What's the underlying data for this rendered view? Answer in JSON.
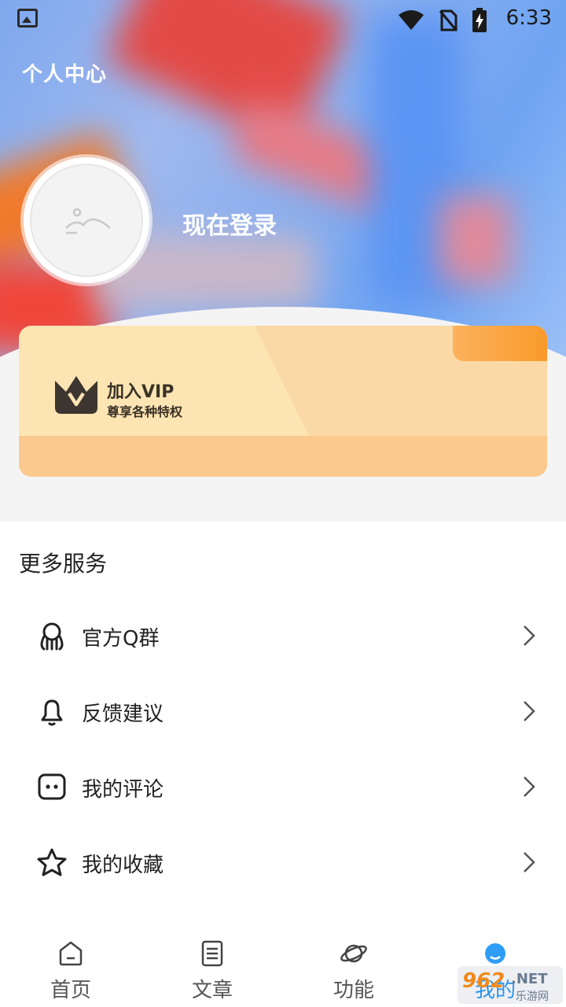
{
  "status_bar": {
    "time": "6:33"
  },
  "header": {
    "title": "个人中心"
  },
  "profile": {
    "login_label": "现在登录"
  },
  "vip_card": {
    "title": "加入VIP",
    "subtitle": "尊享各种特权"
  },
  "services": {
    "title": "更多服务",
    "items": [
      {
        "label": "官方Q群",
        "icon": "qq-group-icon"
      },
      {
        "label": "反馈建议",
        "icon": "bell-icon"
      },
      {
        "label": "我的评论",
        "icon": "comment-icon"
      },
      {
        "label": "我的收藏",
        "icon": "star-icon"
      }
    ]
  },
  "tabbar": {
    "tabs": [
      {
        "label": "首页",
        "icon": "home-icon"
      },
      {
        "label": "文章",
        "icon": "document-icon"
      },
      {
        "label": "功能",
        "icon": "planet-icon"
      },
      {
        "label": "我的",
        "icon": "profile-icon",
        "active": true
      }
    ]
  },
  "watermark": {
    "brand": "962",
    "domain": ".NET",
    "sub": "乐游网"
  },
  "colors": {
    "accent": "#2f9df7",
    "vip_orange": "#f99a2b",
    "vip_cream": "#fde4b3"
  }
}
